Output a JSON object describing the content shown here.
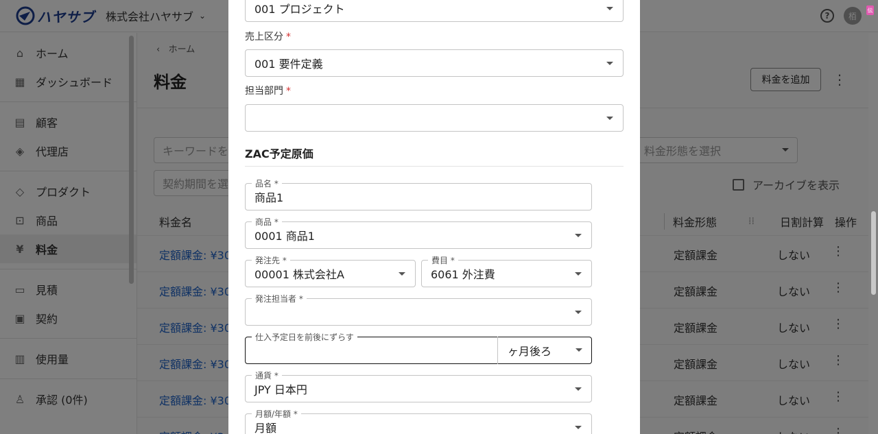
{
  "header": {
    "logo_text": "ハヤサブ",
    "company": "株式会社ハヤサブ",
    "avatar": "栢",
    "help": "?"
  },
  "sidebar": {
    "items": [
      {
        "label": "ホーム",
        "icon": "home-icon",
        "glyph": "⌂"
      },
      {
        "label": "ダッシュボード",
        "icon": "dashboard-icon",
        "glyph": "▦"
      },
      {
        "label": "顧客",
        "icon": "customers-icon",
        "glyph": "▤"
      },
      {
        "label": "代理店",
        "icon": "agency-icon",
        "glyph": "◈"
      },
      {
        "label": "プロダクト",
        "icon": "product-icon",
        "glyph": "◇"
      },
      {
        "label": "商品",
        "icon": "shopping-bag-icon",
        "glyph": "⊡"
      },
      {
        "label": "料金",
        "icon": "yen-icon",
        "glyph": "¥"
      },
      {
        "label": "見積",
        "icon": "document-icon",
        "glyph": "▭"
      },
      {
        "label": "契約",
        "icon": "contract-icon",
        "glyph": "▣"
      },
      {
        "label": "使用量",
        "icon": "bar-chart-icon",
        "glyph": "▥"
      },
      {
        "label": "承認 (0件)",
        "icon": "person-icon",
        "glyph": "♙"
      }
    ]
  },
  "main": {
    "breadcrumb_back": "‹",
    "breadcrumb": "ホーム",
    "title": "料金",
    "add_button": "料金を追加",
    "search_placeholder": "キーワードを",
    "period_placeholder": "契約期間を選",
    "plan_placeholder": "料金形態を選択",
    "archive_label": "アーカイブを表示",
    "columns": {
      "name": "料金名",
      "plan": "料金形態",
      "prorate": "日割計算",
      "actions": "操作"
    },
    "rows": [
      {
        "name": "定額課金: ¥30",
        "plan": "定額課金",
        "prorate": "しない"
      },
      {
        "name": "定額課金: ¥30",
        "plan": "定額課金",
        "prorate": "しない"
      },
      {
        "name": "定額課金: ¥30",
        "plan": "定額課金",
        "prorate": "しない"
      },
      {
        "name": "定額課金: ¥30",
        "plan": "定額課金",
        "prorate": "しない"
      },
      {
        "name": "定額課金: ¥30",
        "plan": "定額課金",
        "prorate": "しない"
      },
      {
        "name": "定額課金: ¥3,0",
        "plan": "定額課金",
        "prorate": "しない"
      }
    ]
  },
  "modal": {
    "project_value": "001 プロジェクト",
    "sales_category_label": "売上区分",
    "sales_category_value": "001 要件定義",
    "department_label": "担当部門",
    "department_value": "",
    "required_mark": "*",
    "section_title": "ZAC予定原価",
    "fields": {
      "item_name": {
        "label": "品名 *",
        "value": "商品1"
      },
      "product": {
        "label": "商品 *",
        "value": "0001 商品1"
      },
      "supplier": {
        "label": "発注先 *",
        "value": "00001 株式会社A"
      },
      "expense": {
        "label": "費目 *",
        "value": "6061 外注費"
      },
      "orderer": {
        "label": "発注担当者 *",
        "value": ""
      },
      "purchase_shift": {
        "label": "仕入予定日を前後にずらす",
        "value": "",
        "unit": "ヶ月後ろ"
      },
      "currency": {
        "label": "通貨 *",
        "value": "JPY 日本円"
      },
      "billing_period": {
        "label": "月額/年額 *",
        "value": "月額"
      }
    }
  }
}
